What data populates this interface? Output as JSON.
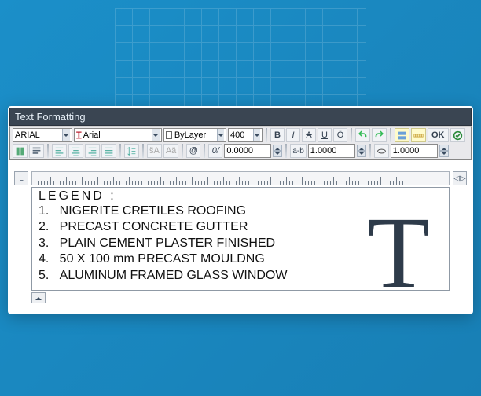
{
  "titlebar": "Text Formatting",
  "row1": {
    "style_dropdown": "ARIAL",
    "font_dropdown": "Arial",
    "layer_dropdown": "ByLayer",
    "height": "400",
    "ok_label": "OK"
  },
  "row2": {
    "tracking": "0.0000",
    "width_factor": "1.0000",
    "oblique": "1.0000"
  },
  "ruler": {
    "left_cap": "L",
    "right_cap": "◁▷"
  },
  "legend": {
    "title": "LEGEND :",
    "items": [
      "NIGERITE CRETILES ROOFING",
      "PRECAST CONCRETE GUTTER",
      "PLAIN CEMENT PLASTER FINISHED",
      "50 X 100 mm PRECAST MOULDNG",
      "ALUMINUM FRAMED GLASS WINDOW"
    ]
  },
  "icons": {
    "bold": "B",
    "italic": "I",
    "strike": "A",
    "underline": "U",
    "overline": "Ō",
    "slash": "0/"
  }
}
